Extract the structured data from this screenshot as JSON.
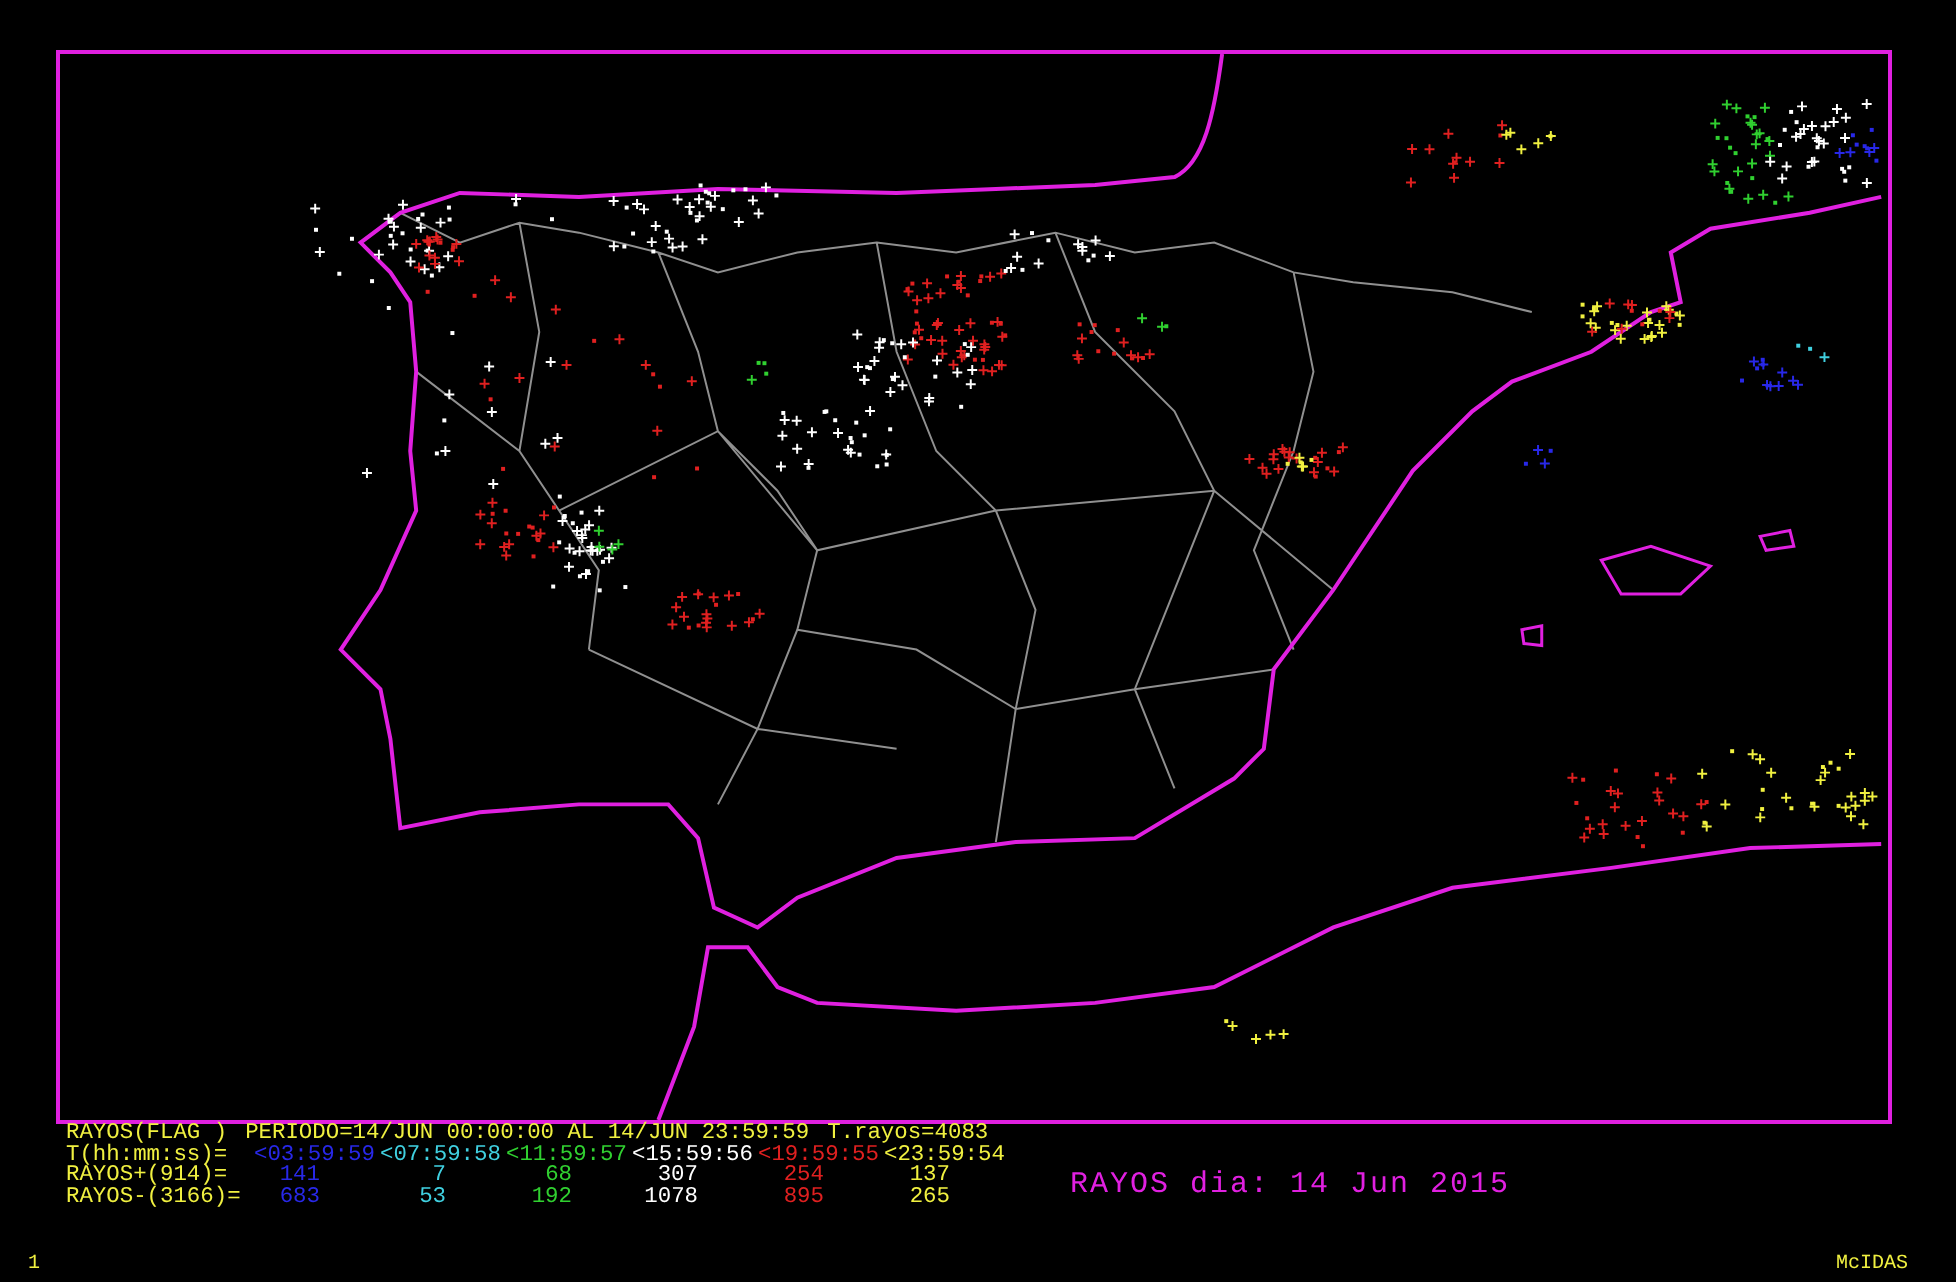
{
  "header": {
    "flag_label": "RAYOS(FLAG )",
    "period": "PERIODO=14/JUN 00:00:00 AL 14/JUN 23:59:59",
    "total": "T.rayos=4083"
  },
  "intervals_label": "T(hh:mm:ss)=",
  "positive_label": "RAYOS+(914)=",
  "negative_label": "RAYOS-(3166)=",
  "intervals": [
    {
      "time": "<03:59:59",
      "color": "#2828e8",
      "positive": "141",
      "negative": "683"
    },
    {
      "time": "<07:59:58",
      "color": "#40d0e0",
      "positive": "7",
      "negative": "53"
    },
    {
      "time": "<11:59:57",
      "color": "#30d030",
      "positive": "68",
      "negative": "192"
    },
    {
      "time": "<15:59:56",
      "color": "#ffffff",
      "positive": "307",
      "negative": "1078"
    },
    {
      "time": "<19:59:55",
      "color": "#e02020",
      "positive": "254",
      "negative": "895"
    },
    {
      "time": "<23:59:54",
      "color": "#f0f040",
      "positive": "137",
      "negative": "265"
    }
  ],
  "map_title": "RAYOS dia: 14 Jun 2015",
  "frame_number": "1",
  "brand": "McIDAS"
}
